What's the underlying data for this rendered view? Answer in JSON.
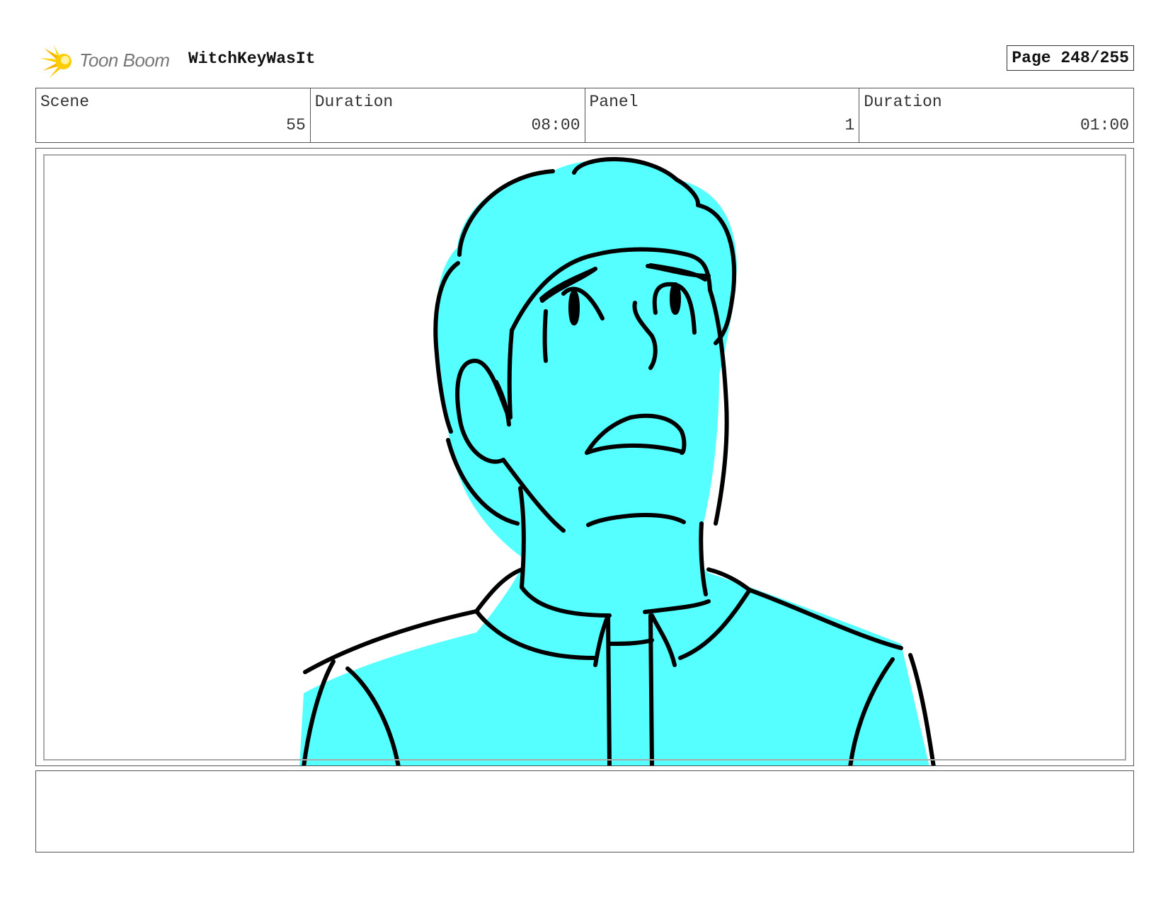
{
  "header": {
    "logo_text": "Toon Boom",
    "project_title": "WitchKeyWasIt",
    "page_label": "Page 248/255"
  },
  "info": {
    "scene_label": "Scene",
    "scene_value": "55",
    "scene_duration_label": "Duration",
    "scene_duration_value": "08:00",
    "panel_label": "Panel",
    "panel_value": "1",
    "panel_duration_label": "Duration",
    "panel_duration_value": "01:00"
  },
  "panel": {
    "fill_color": "#55ffff",
    "line_color": "#000000"
  },
  "notes": {
    "text": ""
  }
}
